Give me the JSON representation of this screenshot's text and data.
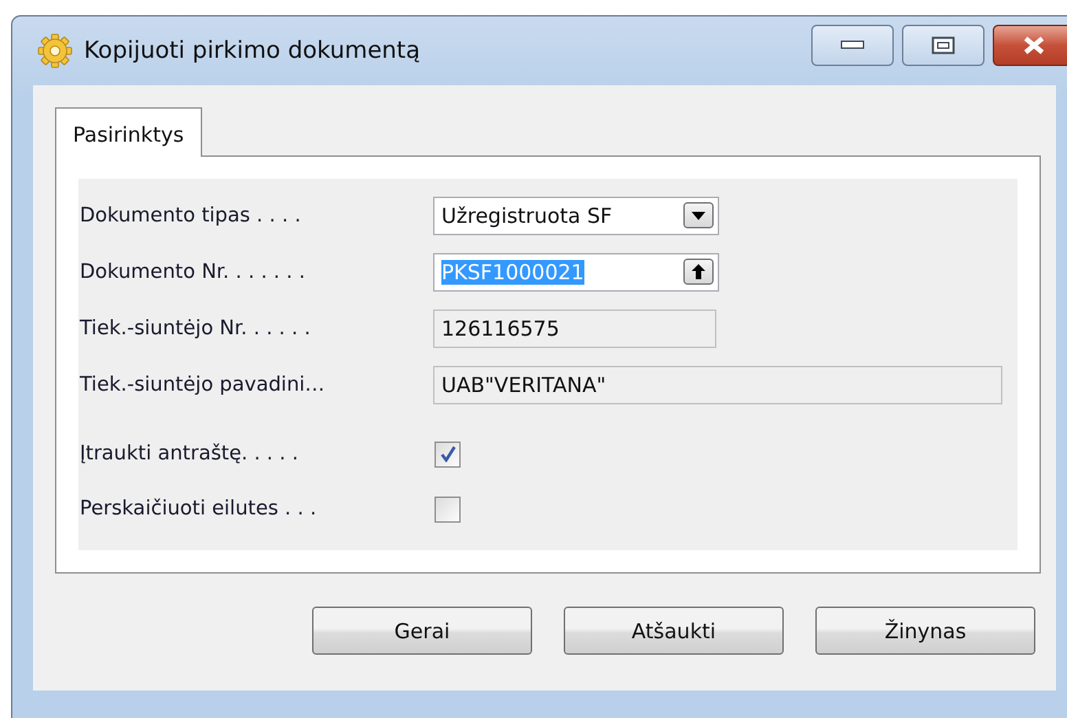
{
  "window": {
    "title": "Kopijuoti pirkimo dokumentą"
  },
  "tabs": [
    {
      "label": "Pasirinktys",
      "selected": true
    }
  ],
  "fields": [
    {
      "kind": "dropdown",
      "label": "Dokumento tipas . . . .",
      "value": "Užregistruota SF"
    },
    {
      "kind": "lookup",
      "label": "Dokumento Nr. . . . . . .",
      "value": "PKSF1000021",
      "highlighted": true
    },
    {
      "kind": "readonly",
      "label": "Tiek.-siuntėjo Nr. . . . . .",
      "value": "126116575"
    },
    {
      "kind": "readonly_wide",
      "label": "Tiek.-siuntėjo pavadini…",
      "value": "UAB\"VERITANA\""
    },
    {
      "kind": "checkbox",
      "label": "Įtraukti antraštę. . . . .",
      "checked": true
    },
    {
      "kind": "checkbox",
      "label": "Perskaičiuoti eilutes . . .",
      "checked": false
    }
  ],
  "buttons": [
    "Gerai",
    "Atšaukti",
    "Žinynas"
  ]
}
